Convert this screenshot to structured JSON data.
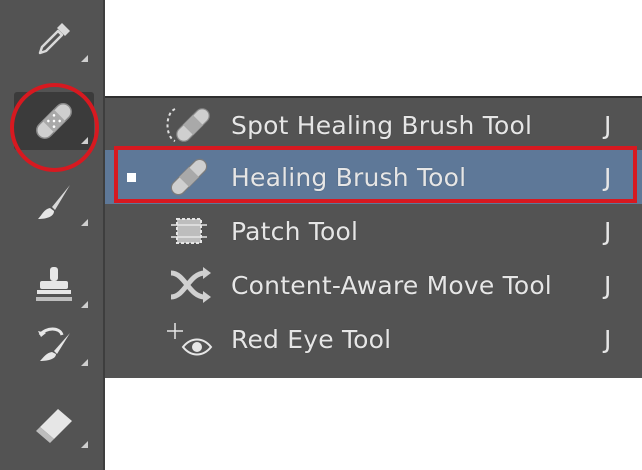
{
  "toolbar": {
    "tools": [
      {
        "name": "eyedropper-tool",
        "icon": "eyedropper-icon"
      },
      {
        "name": "healing-brush-tool",
        "icon": "bandage-icon",
        "active": true
      },
      {
        "name": "brush-tool",
        "icon": "brush-icon"
      },
      {
        "name": "clone-stamp-tool",
        "icon": "stamp-icon"
      },
      {
        "name": "history-brush-tool",
        "icon": "history-brush-icon"
      },
      {
        "name": "eraser-tool",
        "icon": "eraser-icon"
      }
    ]
  },
  "flyout": {
    "items": [
      {
        "label": "Spot Healing Brush Tool",
        "shortcut": "J",
        "icon": "spot-healing-icon",
        "selected": false
      },
      {
        "label": "Healing Brush Tool",
        "shortcut": "J",
        "icon": "bandage-icon",
        "selected": true
      },
      {
        "label": "Patch Tool",
        "shortcut": "J",
        "icon": "patch-icon",
        "selected": false
      },
      {
        "label": "Content-Aware Move Tool",
        "shortcut": "J",
        "icon": "content-aware-move-icon",
        "selected": false
      },
      {
        "label": "Red Eye Tool",
        "shortcut": "J",
        "icon": "red-eye-icon",
        "selected": false
      }
    ]
  },
  "colors": {
    "panel": "#535353",
    "selection": "#5e7898",
    "highlight": "#d71920"
  }
}
